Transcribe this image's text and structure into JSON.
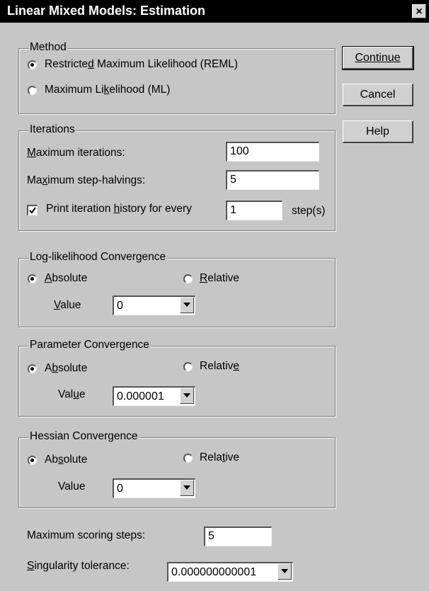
{
  "window": {
    "title": "Linear Mixed Models: Estimation",
    "close_label": "×"
  },
  "buttons": {
    "continue": "Continue",
    "cancel": "Cancel",
    "help": "Help"
  },
  "method": {
    "legend": "Method",
    "reml": {
      "pre": "Restricte",
      "key": "d",
      "post": " Maximum Likelihood (REML)"
    },
    "ml": {
      "pre": "Maximum Li",
      "key": "k",
      "post": "elihood (ML)"
    },
    "selected": "reml"
  },
  "iterations": {
    "legend": "Iterations",
    "max_iter": {
      "pre": "",
      "key": "M",
      "post": "aximum iterations:",
      "value": "100"
    },
    "max_step": {
      "pre": "Ma",
      "key": "x",
      "post": "imum step-halvings:",
      "value": "5"
    },
    "print_history": {
      "pre": "Print iteration ",
      "key": "h",
      "post": "istory for every",
      "value": "1",
      "unit": "step(s)",
      "checked": true
    }
  },
  "loglik": {
    "legend": "Log-likelihood Convergence",
    "absolute": {
      "pre": "",
      "key": "A",
      "post": "bsolute"
    },
    "relative": {
      "pre": "",
      "key": "R",
      "post": "elative"
    },
    "selected": "absolute",
    "value_label": {
      "pre": "",
      "key": "V",
      "post": "alue"
    },
    "value": "0"
  },
  "param": {
    "legend": "Parameter Convergence",
    "absolute": {
      "pre": "A",
      "key": "b",
      "post": "solute"
    },
    "relative": {
      "pre": "Relativ",
      "key": "e",
      "post": ""
    },
    "selected": "absolute",
    "value_label": {
      "pre": "Val",
      "key": "u",
      "post": "e"
    },
    "value": "0.000001"
  },
  "hessian": {
    "legend": "Hessian Convergence",
    "absolute": {
      "pre": "Ab",
      "key": "s",
      "post": "olute"
    },
    "relative": {
      "pre": "Rela",
      "key": "t",
      "post": "ive"
    },
    "selected": "absolute",
    "value_label": {
      "pre": "Value",
      "key": "",
      "post": ""
    },
    "value": "0"
  },
  "scoring": {
    "label": "Maximum scoring steps:",
    "value": "5"
  },
  "singularity": {
    "label": {
      "pre": "",
      "key": "S",
      "post": "ingularity tolerance:"
    },
    "value": "0.000000000001"
  }
}
